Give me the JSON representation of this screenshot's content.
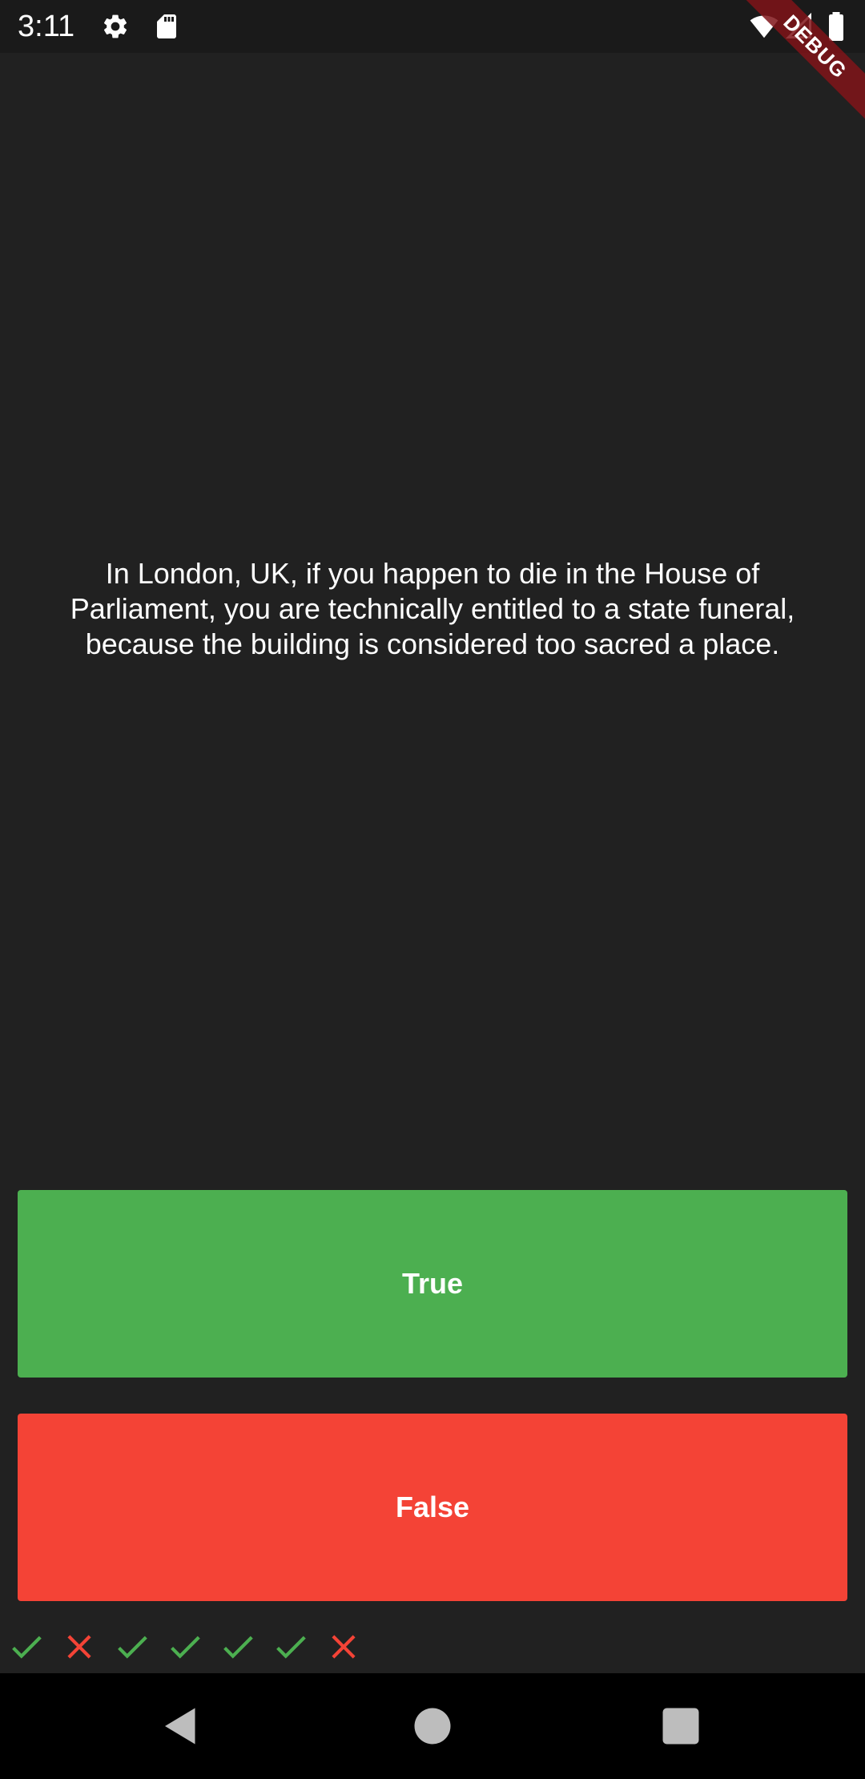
{
  "status_bar": {
    "time": "3:11",
    "icons": [
      "settings-icon",
      "sd-card-icon",
      "wifi-icon",
      "signal-icon",
      "battery-icon"
    ]
  },
  "debug_banner": "DEBUG",
  "question": "In London, UK, if you happen to die in the House of Parliament, you are technically entitled to a state funeral, because the building is considered too sacred a place.",
  "buttons": {
    "true_label": "True",
    "false_label": "False"
  },
  "score_keeper": [
    "check",
    "cross",
    "check",
    "check",
    "check",
    "check",
    "cross"
  ],
  "colors": {
    "background": "#212121",
    "true_button": "#4caf50",
    "false_button": "#f44336",
    "check_icon": "#4caf50",
    "cross_icon": "#f44336"
  },
  "nav_bar": {
    "icons": [
      "back-icon",
      "home-icon",
      "recents-icon"
    ]
  }
}
